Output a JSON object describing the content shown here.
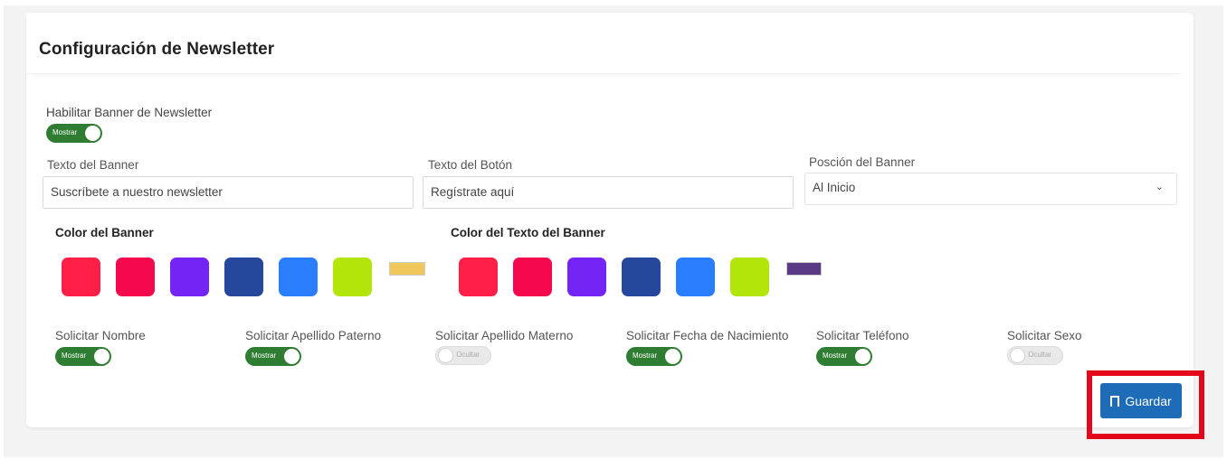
{
  "card": {
    "title": "Configuración de Newsletter"
  },
  "enable_banner": {
    "label": "Habilitar Banner de Newsletter",
    "toggle_text": "Mostrar",
    "state": "on"
  },
  "banner_text": {
    "label": "Texto del Banner",
    "value": "Suscríbete a nuestro newsletter"
  },
  "button_text": {
    "label": "Texto del Botón",
    "value": "Regístrate aquí"
  },
  "banner_position": {
    "label": "Posción del Banner",
    "selected": "Al Inicio"
  },
  "banner_color": {
    "label": "Color del Banner",
    "swatches": [
      "#ff1f47",
      "#f4094f",
      "#7424f5",
      "#25489c",
      "#2a7dfb",
      "#b2e60a"
    ],
    "selected_color": "#f0c75a"
  },
  "text_color": {
    "label": "Color del Texto del Banner",
    "swatches": [
      "#ff1f47",
      "#f4094f",
      "#7424f5",
      "#25489c",
      "#2a7dfb",
      "#b2e60a"
    ],
    "selected_color": "#5b3a85"
  },
  "fields": [
    {
      "label": "Solicitar Nombre",
      "toggle_text": "Mostrar",
      "state": "on"
    },
    {
      "label": "Solicitar Apellido Paterno",
      "toggle_text": "Mostrar",
      "state": "on"
    },
    {
      "label": "Solicitar Apellido Materno",
      "toggle_text": "Ocultar",
      "state": "off"
    },
    {
      "label": "Solicitar Fecha de Nacimiento",
      "toggle_text": "Mostrar",
      "state": "on"
    },
    {
      "label": "Solicitar Teléfono",
      "toggle_text": "Mostrar",
      "state": "on"
    },
    {
      "label": "Solicitar Sexo",
      "toggle_text": "Ocultar",
      "state": "off"
    }
  ],
  "save_button": {
    "label": "Guardar",
    "icon": "save-icon"
  },
  "colors": {
    "accent": "#1e6bb8",
    "toggle_on": "#2e7d32",
    "highlight": "#e3081a"
  }
}
